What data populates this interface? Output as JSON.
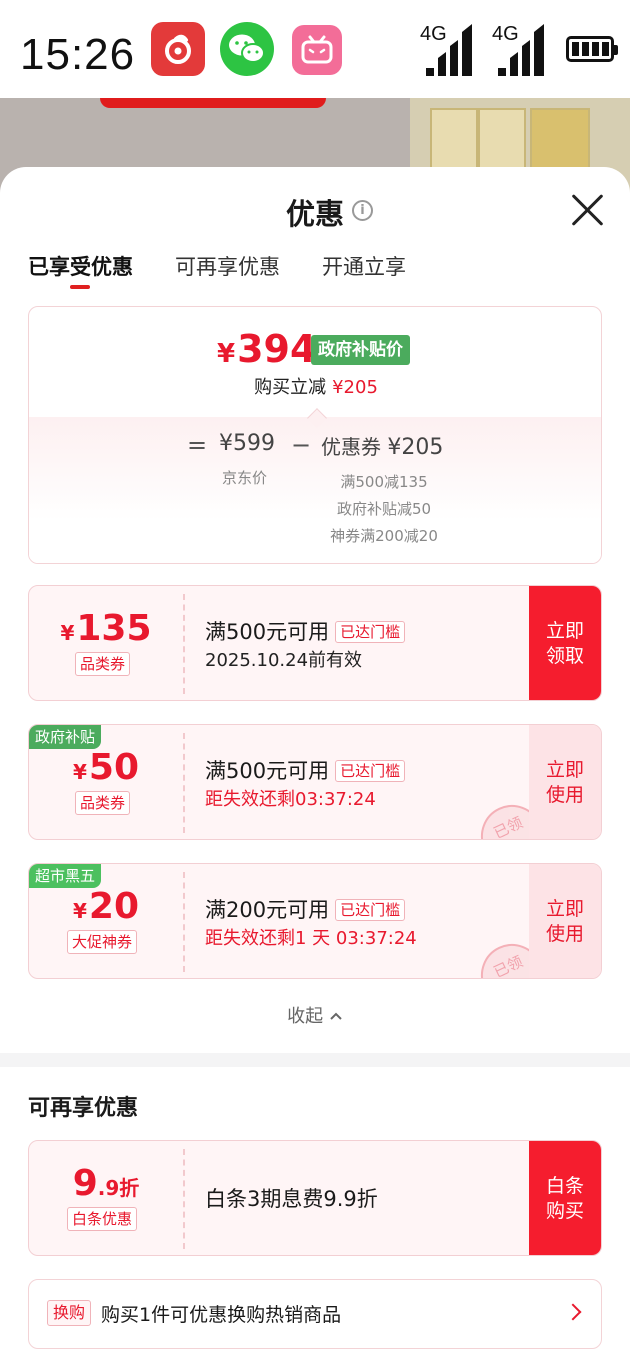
{
  "status_bar": {
    "time": "15:26",
    "network_1": "4G",
    "network_2": "4G",
    "apps": [
      "netease-music-icon",
      "wechat-icon",
      "bilibili-icon"
    ]
  },
  "sheet": {
    "title": "优惠",
    "tabs": [
      {
        "label": "已享受优惠",
        "active": true
      },
      {
        "label": "可再享优惠",
        "active": false
      },
      {
        "label": "开通立享",
        "active": false
      }
    ]
  },
  "summary": {
    "currency": "¥",
    "final_price": "394",
    "price_badge": "政府补贴价",
    "instant_cut_label": "购买立减",
    "instant_cut_amount": "¥205",
    "equals": "=",
    "original_price": "¥599",
    "original_label": "京东价",
    "minus": "−",
    "coupon_label": "优惠券",
    "coupon_total": "¥205",
    "details": [
      "满500减135",
      "政府补贴减50",
      "神券满200减20"
    ]
  },
  "coupons": [
    {
      "corner_tag": "",
      "amount": "135",
      "type": "品类券",
      "condition": "满500元可用",
      "threshold_tag": "已达门槛",
      "validity": "2025.10.24前有效",
      "cta_line1": "立即",
      "cta_line2": "领取"
    },
    {
      "corner_tag": "政府补贴",
      "amount": "50",
      "type": "品类券",
      "condition": "满500元可用",
      "threshold_tag": "已达门槛",
      "validity": "距失效还剩03:37:24",
      "cta_line1": "立即",
      "cta_line2": "使用",
      "stamp": "已领"
    },
    {
      "corner_tag": "超市黑五",
      "amount": "20",
      "type": "大促神券",
      "condition": "满200元可用",
      "threshold_tag": "已达门槛",
      "validity": "距失效还剩1 天 03:37:24",
      "cta_line1": "立即",
      "cta_line2": "使用",
      "stamp": "已领"
    }
  ],
  "collapse_label": "收起",
  "more_section": {
    "title": "可再享优惠",
    "baitiao": {
      "discount_main": "9",
      "discount_sub": ".9折",
      "type": "白条优惠",
      "description": "白条3期息费9.9折",
      "cta_line1": "白条",
      "cta_line2": "购买"
    },
    "swap": {
      "tag": "换购",
      "text": "购买1件可优惠换购热销商品"
    }
  },
  "colors": {
    "accent_red": "#e8192e",
    "cta_red": "#f51d2e",
    "badge_green": "#4bab5d"
  }
}
